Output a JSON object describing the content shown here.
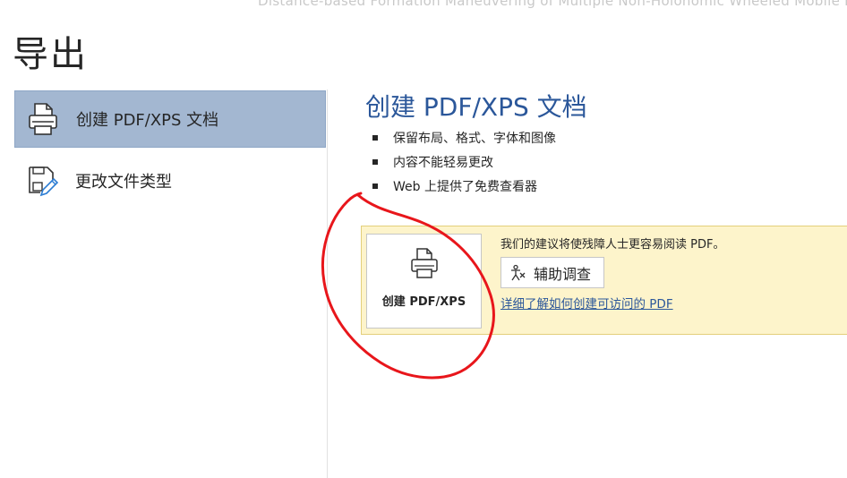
{
  "document_title": "Distance-based Formation Maneuvering of Multiple Non-Holonomic Wheeled Mobile Robo",
  "page_heading": "导出",
  "sidebar": {
    "items": [
      {
        "label": "创建 PDF/XPS 文档",
        "icon": "printer-icon",
        "selected": true
      },
      {
        "label": "更改文件类型",
        "icon": "change-file-type-icon",
        "selected": false
      }
    ]
  },
  "main": {
    "title": "创建 PDF/XPS 文档",
    "bullets": [
      "保留布局、格式、字体和图像",
      "内容不能轻易更改",
      "Web 上提供了免费查看器"
    ],
    "create_button": {
      "label": "创建 PDF/XPS",
      "icon": "printer-icon"
    },
    "accessibility": {
      "message": "我们的建议将使残障人士更容易阅读 PDF。",
      "button_label": "辅助调查",
      "button_icon": "accessibility-icon",
      "link": "详细了解如何创建可访问的 PDF"
    }
  },
  "colors": {
    "accent": "#2b579a",
    "selected_nav": "#a3b7d1",
    "panel_bg": "#fdf4cb",
    "annotation": "#e8161b"
  }
}
